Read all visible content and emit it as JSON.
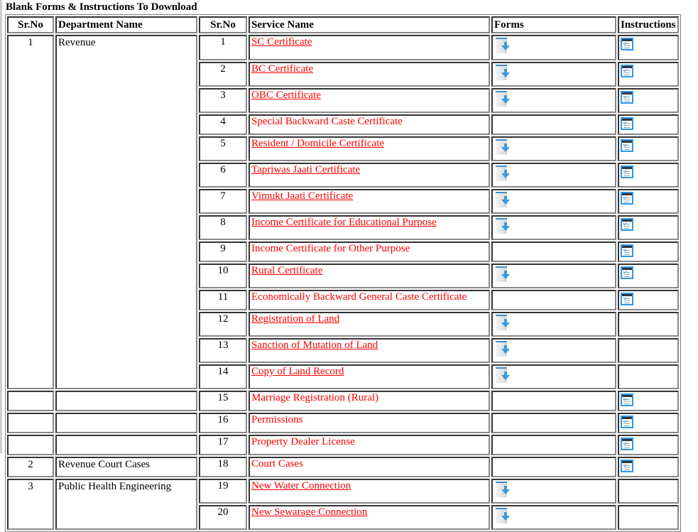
{
  "page": {
    "title": "Blank Forms & Instructions To Download"
  },
  "table": {
    "headers": {
      "dept_srno": "Sr.No",
      "dept_name": "Department Name",
      "svc_srno": "Sr.No",
      "svc_name": "Service Name",
      "forms": "Forms",
      "instructions": "Instructions"
    },
    "departments": [
      {
        "srno": "1",
        "name": "Revenue"
      },
      {
        "srno": "",
        "name": ""
      },
      {
        "srno": "",
        "name": ""
      },
      {
        "srno": "",
        "name": ""
      },
      {
        "srno": "2",
        "name": "Revenue Court Cases"
      },
      {
        "srno": "3",
        "name": "Public Health Engineering"
      }
    ],
    "services": [
      {
        "srno": "1",
        "name": "SC Certificate",
        "linked": true,
        "form": true,
        "instruction": true
      },
      {
        "srno": "2",
        "name": "BC Certificate",
        "linked": true,
        "form": true,
        "instruction": true
      },
      {
        "srno": "3",
        "name": "OBC Certificate",
        "linked": true,
        "form": true,
        "instruction": true
      },
      {
        "srno": "4",
        "name": "Special Backward Caste Certificate",
        "linked": false,
        "form": false,
        "instruction": true
      },
      {
        "srno": "5",
        "name": "Resident / Domicile Certificate",
        "linked": true,
        "form": true,
        "instruction": true
      },
      {
        "srno": "6",
        "name": "Tapriwas Jaati Certificate",
        "linked": true,
        "form": true,
        "instruction": true
      },
      {
        "srno": "7",
        "name": "Vimukt Jaati Certificate",
        "linked": true,
        "form": true,
        "instruction": true
      },
      {
        "srno": "8",
        "name": "Income Certificate for Educational Purpose",
        "linked": true,
        "form": true,
        "instruction": true
      },
      {
        "srno": "9",
        "name": "Income Certificate for Other Purpose",
        "linked": false,
        "form": false,
        "instruction": true
      },
      {
        "srno": "10",
        "name": "Rural Certificate",
        "linked": true,
        "form": true,
        "instruction": true
      },
      {
        "srno": "11",
        "name": "Economically Backward General Caste Certificate",
        "linked": false,
        "form": false,
        "instruction": true
      },
      {
        "srno": "12",
        "name": "Registration of Land",
        "linked": true,
        "form": true,
        "instruction": false
      },
      {
        "srno": "13",
        "name": "Sanction of Mutation of Land",
        "linked": true,
        "form": true,
        "instruction": false
      },
      {
        "srno": "14",
        "name": "Copy of Land Record",
        "linked": true,
        "form": true,
        "instruction": false
      },
      {
        "srno": "15",
        "name": "Marriage Registration (Rural)",
        "linked": false,
        "form": false,
        "instruction": true
      },
      {
        "srno": "16",
        "name": "Permissions",
        "linked": false,
        "form": false,
        "instruction": true
      },
      {
        "srno": "17",
        "name": "Property Dealer License",
        "linked": false,
        "form": false,
        "instruction": true
      },
      {
        "srno": "18",
        "name": "Court Cases",
        "linked": false,
        "form": false,
        "instruction": true
      },
      {
        "srno": "19",
        "name": "New Water Connection",
        "linked": true,
        "form": true,
        "instruction": false
      },
      {
        "srno": "20",
        "name": "New Sewarage Connection",
        "linked": true,
        "form": true,
        "instruction": false
      }
    ],
    "icons": {
      "form": "download-form-icon",
      "instruction": "instructions-checklist-icon"
    }
  },
  "colors": {
    "link": "#ff0000",
    "icon_blue": "#3a9ae0"
  }
}
